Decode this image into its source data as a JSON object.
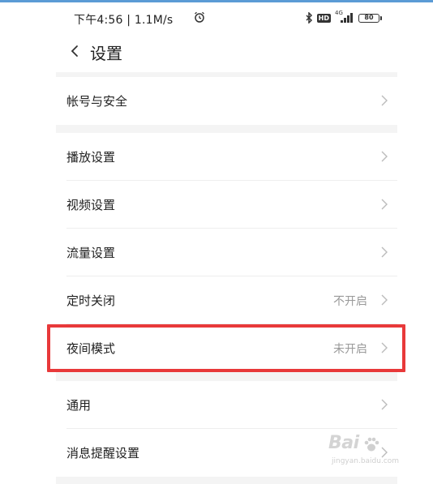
{
  "status_bar": {
    "time_speed": "下午4:56 | 1.1M/s",
    "network": "4G",
    "battery": "80"
  },
  "header": {
    "title": "设置"
  },
  "groups": [
    {
      "items": [
        {
          "label": "帐号与安全",
          "value": ""
        }
      ]
    },
    {
      "items": [
        {
          "label": "播放设置",
          "value": ""
        },
        {
          "label": "视频设置",
          "value": ""
        },
        {
          "label": "流量设置",
          "value": ""
        },
        {
          "label": "定时关闭",
          "value": "不开启"
        },
        {
          "label": "夜间模式",
          "value": "未开启"
        }
      ]
    },
    {
      "items": [
        {
          "label": "通用",
          "value": ""
        },
        {
          "label": "消息提醒设置",
          "value": ""
        }
      ]
    }
  ],
  "watermark": {
    "brand": "Bai",
    "url": "jingyan.baidu.com"
  },
  "colors": {
    "highlight": "#e8393a",
    "top_line": "#5b9bd5"
  }
}
